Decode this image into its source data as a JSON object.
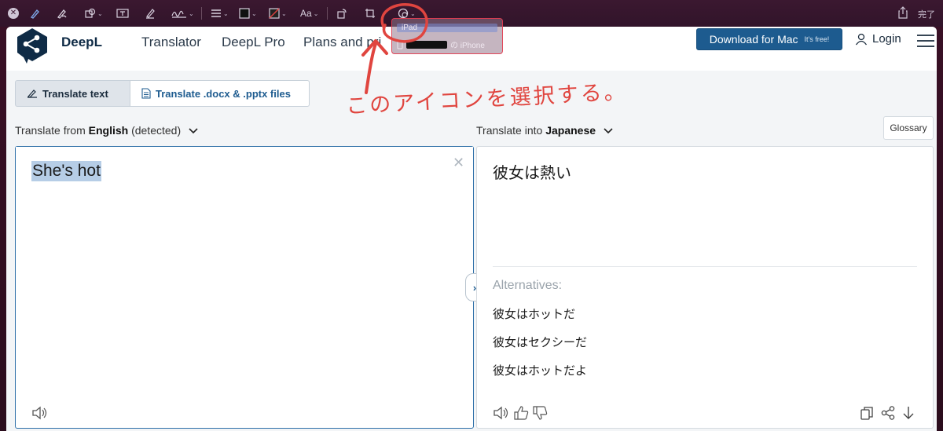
{
  "toolbar": {
    "aa_label": "Aa",
    "done_label": "完了"
  },
  "share_popover": {
    "ipad_label": "iPad",
    "iphone_suffix": "の iPhone"
  },
  "header": {
    "brand": "DeepL",
    "nav": [
      "Translator",
      "DeepL Pro",
      "Plans and pri"
    ],
    "download_label": "Download for Mac",
    "download_note": "It's free!",
    "login_label": "Login"
  },
  "tabs": {
    "translate_text": "Translate text",
    "translate_files": "Translate .docx & .pptx files"
  },
  "source_lang": {
    "prefix": "Translate from ",
    "language": "English",
    "suffix": " (detected)"
  },
  "target_lang": {
    "prefix": "Translate into ",
    "language": "Japanese"
  },
  "glossary_label": "Glossary",
  "source_text": "She's hot",
  "target_text": "彼女は熱い",
  "alternatives": {
    "label": "Alternatives:",
    "items": [
      "彼女はホットだ",
      "彼女はセクシーだ",
      "彼女はホットだよ"
    ]
  },
  "annotation": {
    "text": "このアイコンを選択する。",
    "color": "#e0453f"
  },
  "colors": {
    "accent": "#1d5b8f",
    "brand_dark": "#0f2b46",
    "highlight": "#b6cde6"
  }
}
